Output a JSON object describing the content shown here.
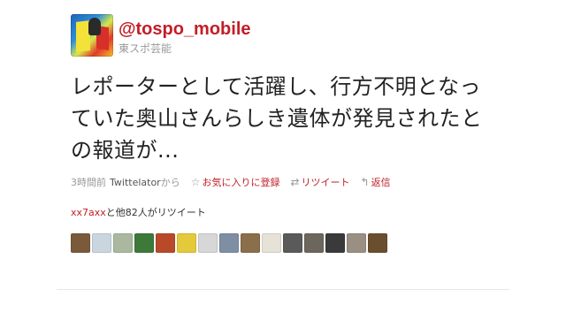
{
  "user": {
    "screen_name": "@tospo_mobile",
    "full_name": "東スポ芸能"
  },
  "tweet": {
    "text": "レポーターとして活躍し、行方不明となっていた奥山さんらしき遺体が発見されたとの報道が..."
  },
  "meta": {
    "time": "3時間前",
    "app": "Twittelator",
    "from": "から",
    "favorite_label": "お気に入りに登録",
    "retweet_label": "リツイート",
    "reply_label": "返信"
  },
  "retweeters": {
    "user": "xx7axx",
    "suffix": "と他82人がリツイート"
  },
  "icons": {
    "favorite": "star-icon",
    "retweet": "retweet-icon",
    "reply": "reply-icon"
  },
  "colors": {
    "accent": "#c21e27",
    "muted": "#999999",
    "text": "#222222"
  },
  "thumbnails": [
    {
      "name": "retweeter-avatar-1",
      "color": "#7a5a3a"
    },
    {
      "name": "retweeter-avatar-2",
      "color": "#c9d6df"
    },
    {
      "name": "retweeter-avatar-3",
      "color": "#aab8a0"
    },
    {
      "name": "retweeter-avatar-4",
      "color": "#3d7a3a"
    },
    {
      "name": "retweeter-avatar-5",
      "color": "#b84a2a"
    },
    {
      "name": "retweeter-avatar-6",
      "color": "#e4c93a"
    },
    {
      "name": "retweeter-avatar-7",
      "color": "#d7d7d7"
    },
    {
      "name": "retweeter-avatar-8",
      "color": "#7f8fa3"
    },
    {
      "name": "retweeter-avatar-9",
      "color": "#8a6f4a"
    },
    {
      "name": "retweeter-avatar-10",
      "color": "#e6e2d7"
    },
    {
      "name": "retweeter-avatar-11",
      "color": "#5a5a5a"
    },
    {
      "name": "retweeter-avatar-12",
      "color": "#6d665c"
    },
    {
      "name": "retweeter-avatar-13",
      "color": "#3a3a3a"
    },
    {
      "name": "retweeter-avatar-14",
      "color": "#9a8f83"
    },
    {
      "name": "retweeter-avatar-15",
      "color": "#6a4f2f"
    }
  ]
}
